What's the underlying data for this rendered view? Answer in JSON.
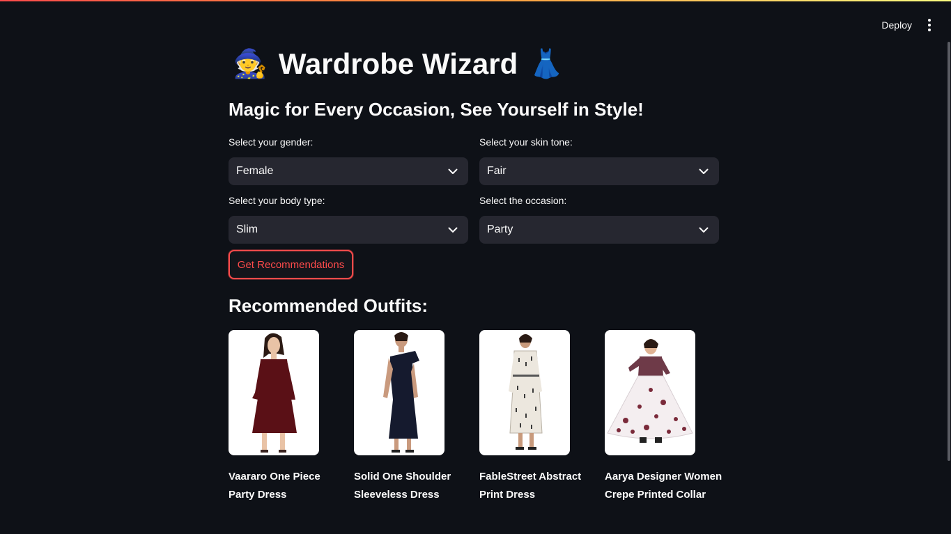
{
  "header": {
    "deploy_label": "Deploy"
  },
  "app": {
    "title": "Wardrobe Wizard",
    "title_emoji_left": "🧙",
    "title_emoji_right": "👗",
    "subtitle": "Magic for Every Occasion, See Yourself in Style!"
  },
  "form": {
    "gender": {
      "label": "Select your gender:",
      "value": "Female"
    },
    "skin_tone": {
      "label": "Select your skin tone:",
      "value": "Fair"
    },
    "body_type": {
      "label": "Select your body type:",
      "value": "Slim"
    },
    "occasion": {
      "label": "Select the occasion:",
      "value": "Party"
    },
    "submit_label": "Get Recommendations"
  },
  "results": {
    "heading": "Recommended Outfits:",
    "items": [
      {
        "name": "Vaararo One Piece Party Dress",
        "dress_color": "#5a1016"
      },
      {
        "name": "Solid One Shoulder Sleeveless Dress",
        "dress_color": "#151a2e"
      },
      {
        "name": "FableStreet Abstract Print Dress",
        "dress_color": "#ece7de"
      },
      {
        "name": "Aarya Designer Women Crepe Printed Collar",
        "dress_color": "#6e3a48"
      }
    ]
  },
  "colors": {
    "background": "#0e1117",
    "input_bg": "#262730",
    "accent": "#ff4b4b"
  }
}
